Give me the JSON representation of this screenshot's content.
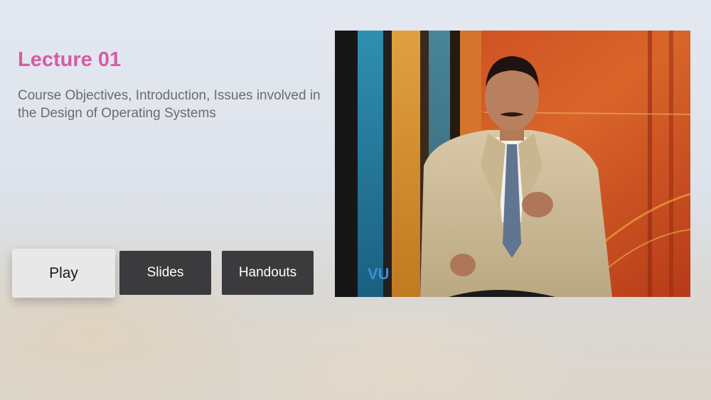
{
  "lecture": {
    "title": "Lecture 01",
    "description": "Course Objectives, Introduction, Issues involved in the Design of Operating Systems"
  },
  "buttons": {
    "play": "Play",
    "slides": "Slides",
    "handouts": "Handouts"
  },
  "video": {
    "watermark": "VU"
  },
  "colors": {
    "title": "#d55ca6",
    "button_dark": "#3b3b3d",
    "button_focused": "#e8e8e8"
  }
}
